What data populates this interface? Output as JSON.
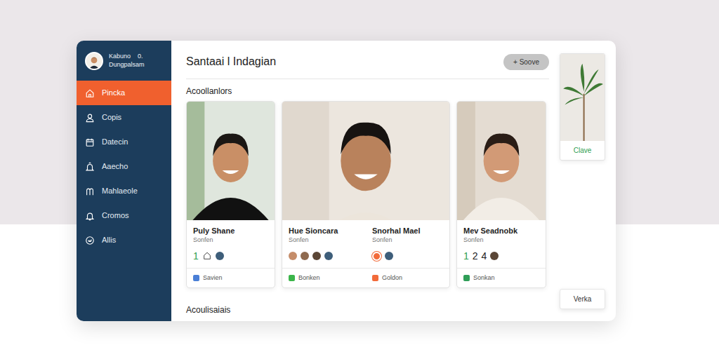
{
  "user": {
    "name": "Kabuno",
    "badge": "0.",
    "subtitle": "Dungpalsam"
  },
  "sidebar": {
    "items": [
      {
        "label": "Pincka",
        "selected": true
      },
      {
        "label": "Copis",
        "selected": false
      },
      {
        "label": "Datecin",
        "selected": false
      },
      {
        "label": "Aaecho",
        "selected": false
      },
      {
        "label": "Mahlaeole",
        "selected": false
      },
      {
        "label": "Cromos",
        "selected": false
      },
      {
        "label": "Allis",
        "selected": false
      }
    ]
  },
  "page": {
    "title": "Santaai l Indagian",
    "button": "+ Soove"
  },
  "sections": [
    "Acoollanlors",
    "Acoulisaiais"
  ],
  "cards": [
    {
      "people": [
        {
          "name": "Puly Shane",
          "subtitle": "Sonfen",
          "stats": [
            {
              "kind": "count",
              "text": "1",
              "color": "#2e9e4f"
            },
            {
              "kind": "icon"
            },
            {
              "kind": "avatar"
            }
          ]
        }
      ],
      "footer": [
        {
          "label": "Savien",
          "color": "#4a7fd6"
        }
      ]
    },
    {
      "people": [
        {
          "name": "Hue Sioncara",
          "subtitle": "Sonfen",
          "stats": [
            {
              "kind": "avatar"
            },
            {
              "kind": "avatar"
            },
            {
              "kind": "avatar"
            },
            {
              "kind": "avatar"
            }
          ]
        },
        {
          "name": "Snorhal Mael",
          "subtitle": "Sonfen",
          "stats": [
            {
              "kind": "dot",
              "color": "#f26b3a"
            },
            {
              "kind": "avatar"
            }
          ]
        }
      ],
      "footer": [
        {
          "label": "Bonken",
          "color": "#3bb54a"
        },
        {
          "label": "Goldon",
          "color": "#f26b3a"
        }
      ]
    },
    {
      "people": [
        {
          "name": "Mev Seadnobk",
          "subtitle": "Sonfen",
          "stats": [
            {
              "kind": "count",
              "text": "1",
              "color": "#2e9e4f"
            },
            {
              "kind": "count",
              "text": "2",
              "color": "#222222"
            },
            {
              "kind": "count",
              "text": "4",
              "color": "#222222"
            },
            {
              "kind": "avatar"
            }
          ]
        }
      ],
      "footer": [
        {
          "label": "Sonkan",
          "color": "#2f9e57"
        }
      ]
    }
  ],
  "side_card": {
    "caption": "Clave"
  },
  "buttons": [
    "Verka"
  ]
}
